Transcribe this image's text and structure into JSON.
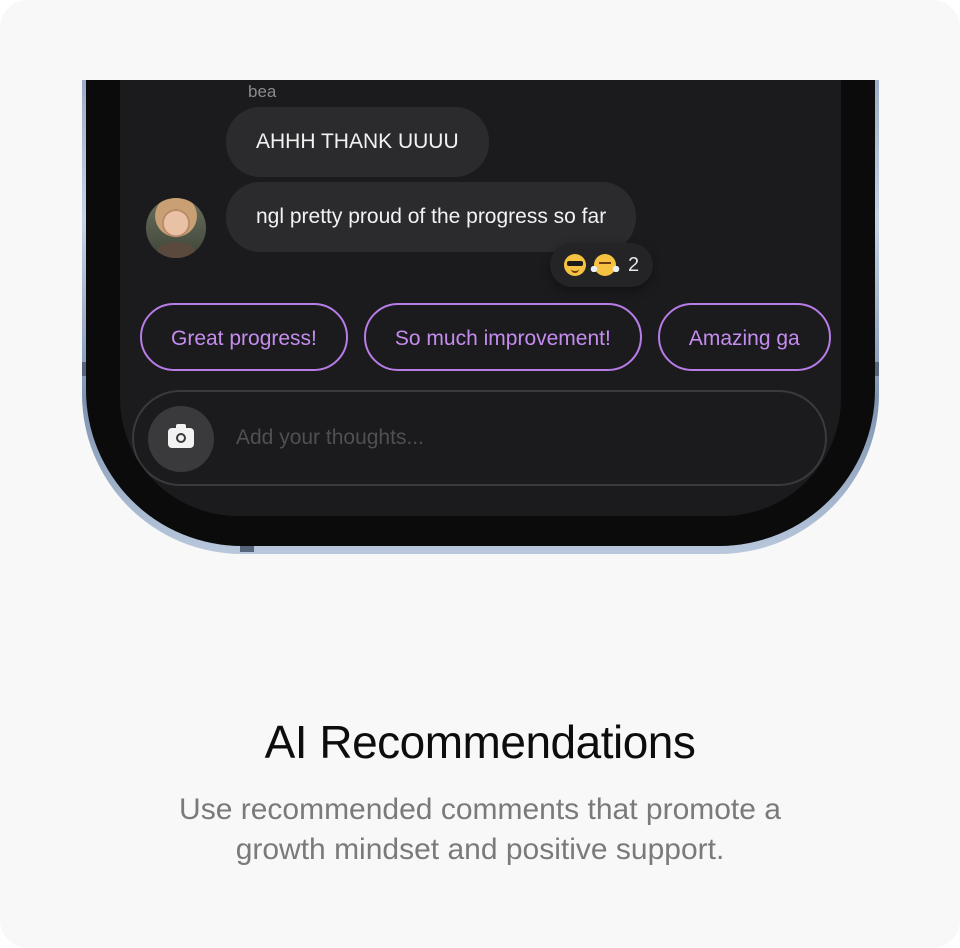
{
  "chat": {
    "sender_name": "bea",
    "messages": [
      {
        "text": "AHHH THANK UUUU"
      },
      {
        "text": "ngl pretty proud of the progress so far"
      }
    ],
    "reactions": {
      "emojis": [
        "smiling-face-with-sunglasses",
        "face-with-steam-from-nose"
      ],
      "count": "2"
    }
  },
  "suggestions": [
    {
      "label": "Great progress!"
    },
    {
      "label": "So much improvement!"
    },
    {
      "label": "Amazing ga"
    }
  ],
  "composer": {
    "placeholder": "Add your thoughts...",
    "camera_icon": "camera-icon"
  },
  "caption": {
    "title": "AI Recommendations",
    "subtitle": "Use recommended comments that promote a growth mindset and positive support."
  },
  "colors": {
    "chip_accent": "#c58cf0",
    "screen_bg": "#1b1b1d",
    "bubble_bg": "#2b2b2e",
    "card_bg": "#f8f8f8"
  }
}
